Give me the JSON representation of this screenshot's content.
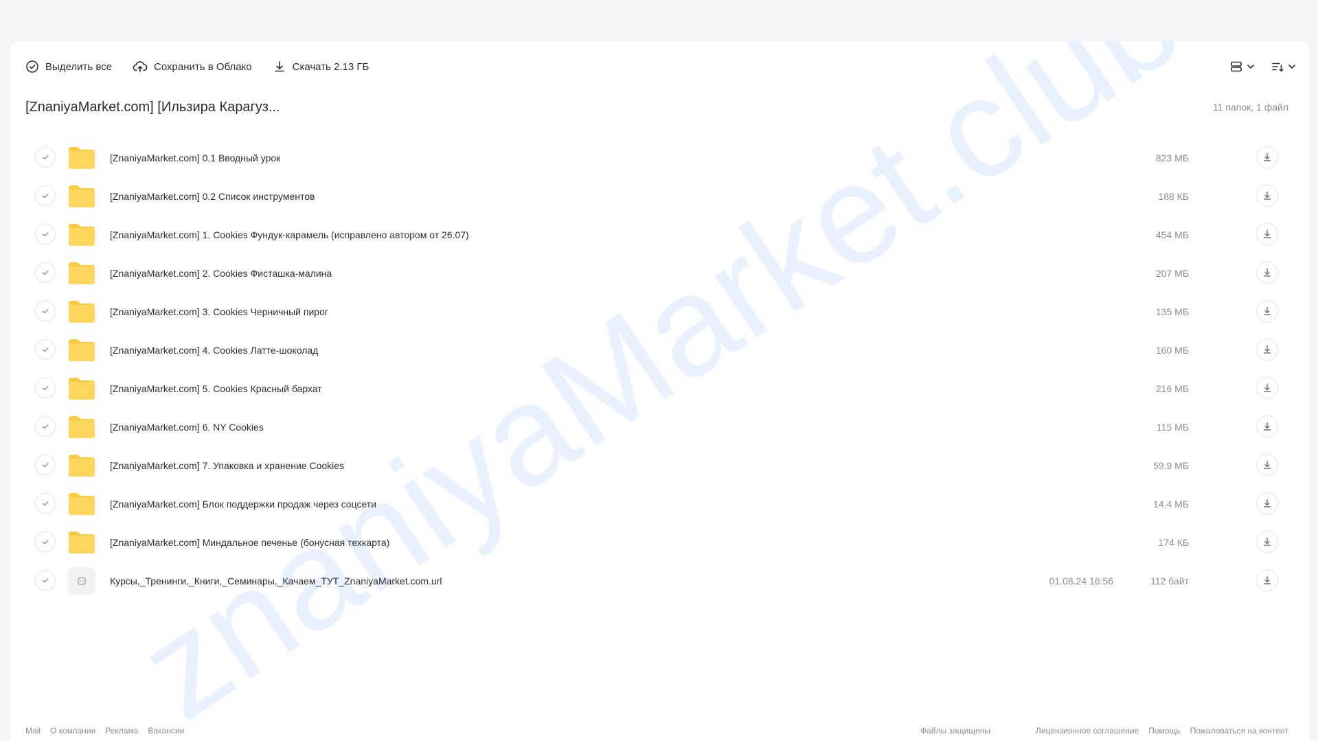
{
  "toolbar": {
    "select_all": "Выделить все",
    "save_to_cloud": "Сохранить в Облако",
    "download": "Скачать 2.13 ГБ"
  },
  "header": {
    "title": "[ZnaniyaMarket.com] [Ильзира Карагуз...",
    "summary": "11 папок, 1 файл"
  },
  "watermark": {
    "text": "znaniyaMarket.club",
    "color": "#e8f1fd"
  },
  "items": [
    {
      "type": "folder",
      "name": "[ZnaniyaMarket.com] 0.1 Вводный урок",
      "date": "",
      "size": "823 МБ"
    },
    {
      "type": "folder",
      "name": "[ZnaniyaMarket.com] 0.2 Список инструментов",
      "date": "",
      "size": "188 КБ"
    },
    {
      "type": "folder",
      "name": "[ZnaniyaMarket.com] 1. Cookies Фундук-карамель (исправлено автором от 26.07)",
      "date": "",
      "size": "454 МБ"
    },
    {
      "type": "folder",
      "name": "[ZnaniyaMarket.com] 2. Cookies Фисташка-малина",
      "date": "",
      "size": "207 МБ"
    },
    {
      "type": "folder",
      "name": "[ZnaniyaMarket.com] 3. Cookies Черничный пирог",
      "date": "",
      "size": "135 МБ"
    },
    {
      "type": "folder",
      "name": "[ZnaniyaMarket.com] 4. Cookies Латте-шоколад",
      "date": "",
      "size": "160 МБ"
    },
    {
      "type": "folder",
      "name": "[ZnaniyaMarket.com] 5. Cookies Красный бархат",
      "date": "",
      "size": "216 МБ"
    },
    {
      "type": "folder",
      "name": "[ZnaniyaMarket.com] 6. NY Cookies",
      "date": "",
      "size": "115 МБ"
    },
    {
      "type": "folder",
      "name": "[ZnaniyaMarket.com] 7. Упаковка и хранение Cookies",
      "date": "",
      "size": "59.9 МБ"
    },
    {
      "type": "folder",
      "name": "[ZnaniyaMarket.com] Блок поддержки продаж через соцсети",
      "date": "",
      "size": "14.4 МБ"
    },
    {
      "type": "folder",
      "name": "[ZnaniyaMarket.com] Миндальное печенье (бонусная техкарта)",
      "date": "",
      "size": "174 КБ"
    },
    {
      "type": "file",
      "name": "Курсы,_Тренинги,_Книги,_Семинары,_Качаем_ТУТ_ZnaniyaMarket.com.url",
      "date": "01.08.24 16:56",
      "size": "112 байт"
    }
  ],
  "footer": {
    "left": [
      "Mail",
      "О компании",
      "Реклама",
      "Вакансии"
    ],
    "mid": "Файлы защищены",
    "right": [
      "Лицензионное соглашение",
      "Помощь",
      "Пожаловаться на контент"
    ]
  },
  "colors": {
    "folder": "#ffd75e",
    "folder_back": "#fcc944",
    "text": "#2c2d2e",
    "muted": "#8a8d92",
    "background": "#f4f5f7"
  }
}
